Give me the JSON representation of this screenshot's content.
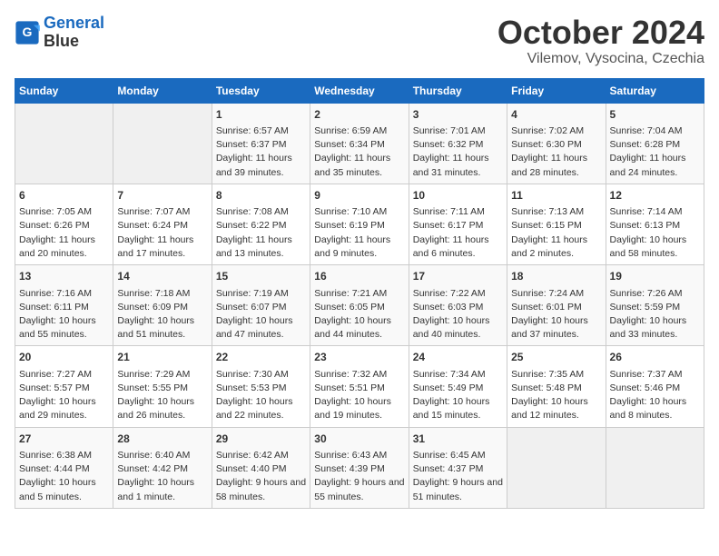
{
  "header": {
    "logo_line1": "General",
    "logo_line2": "Blue",
    "month": "October 2024",
    "location": "Vilemov, Vysocina, Czechia"
  },
  "days_of_week": [
    "Sunday",
    "Monday",
    "Tuesday",
    "Wednesday",
    "Thursday",
    "Friday",
    "Saturday"
  ],
  "weeks": [
    [
      {
        "day": "",
        "info": ""
      },
      {
        "day": "",
        "info": ""
      },
      {
        "day": "1",
        "info": "Sunrise: 6:57 AM\nSunset: 6:37 PM\nDaylight: 11 hours and 39 minutes."
      },
      {
        "day": "2",
        "info": "Sunrise: 6:59 AM\nSunset: 6:34 PM\nDaylight: 11 hours and 35 minutes."
      },
      {
        "day": "3",
        "info": "Sunrise: 7:01 AM\nSunset: 6:32 PM\nDaylight: 11 hours and 31 minutes."
      },
      {
        "day": "4",
        "info": "Sunrise: 7:02 AM\nSunset: 6:30 PM\nDaylight: 11 hours and 28 minutes."
      },
      {
        "day": "5",
        "info": "Sunrise: 7:04 AM\nSunset: 6:28 PM\nDaylight: 11 hours and 24 minutes."
      }
    ],
    [
      {
        "day": "6",
        "info": "Sunrise: 7:05 AM\nSunset: 6:26 PM\nDaylight: 11 hours and 20 minutes."
      },
      {
        "day": "7",
        "info": "Sunrise: 7:07 AM\nSunset: 6:24 PM\nDaylight: 11 hours and 17 minutes."
      },
      {
        "day": "8",
        "info": "Sunrise: 7:08 AM\nSunset: 6:22 PM\nDaylight: 11 hours and 13 minutes."
      },
      {
        "day": "9",
        "info": "Sunrise: 7:10 AM\nSunset: 6:19 PM\nDaylight: 11 hours and 9 minutes."
      },
      {
        "day": "10",
        "info": "Sunrise: 7:11 AM\nSunset: 6:17 PM\nDaylight: 11 hours and 6 minutes."
      },
      {
        "day": "11",
        "info": "Sunrise: 7:13 AM\nSunset: 6:15 PM\nDaylight: 11 hours and 2 minutes."
      },
      {
        "day": "12",
        "info": "Sunrise: 7:14 AM\nSunset: 6:13 PM\nDaylight: 10 hours and 58 minutes."
      }
    ],
    [
      {
        "day": "13",
        "info": "Sunrise: 7:16 AM\nSunset: 6:11 PM\nDaylight: 10 hours and 55 minutes."
      },
      {
        "day": "14",
        "info": "Sunrise: 7:18 AM\nSunset: 6:09 PM\nDaylight: 10 hours and 51 minutes."
      },
      {
        "day": "15",
        "info": "Sunrise: 7:19 AM\nSunset: 6:07 PM\nDaylight: 10 hours and 47 minutes."
      },
      {
        "day": "16",
        "info": "Sunrise: 7:21 AM\nSunset: 6:05 PM\nDaylight: 10 hours and 44 minutes."
      },
      {
        "day": "17",
        "info": "Sunrise: 7:22 AM\nSunset: 6:03 PM\nDaylight: 10 hours and 40 minutes."
      },
      {
        "day": "18",
        "info": "Sunrise: 7:24 AM\nSunset: 6:01 PM\nDaylight: 10 hours and 37 minutes."
      },
      {
        "day": "19",
        "info": "Sunrise: 7:26 AM\nSunset: 5:59 PM\nDaylight: 10 hours and 33 minutes."
      }
    ],
    [
      {
        "day": "20",
        "info": "Sunrise: 7:27 AM\nSunset: 5:57 PM\nDaylight: 10 hours and 29 minutes."
      },
      {
        "day": "21",
        "info": "Sunrise: 7:29 AM\nSunset: 5:55 PM\nDaylight: 10 hours and 26 minutes."
      },
      {
        "day": "22",
        "info": "Sunrise: 7:30 AM\nSunset: 5:53 PM\nDaylight: 10 hours and 22 minutes."
      },
      {
        "day": "23",
        "info": "Sunrise: 7:32 AM\nSunset: 5:51 PM\nDaylight: 10 hours and 19 minutes."
      },
      {
        "day": "24",
        "info": "Sunrise: 7:34 AM\nSunset: 5:49 PM\nDaylight: 10 hours and 15 minutes."
      },
      {
        "day": "25",
        "info": "Sunrise: 7:35 AM\nSunset: 5:48 PM\nDaylight: 10 hours and 12 minutes."
      },
      {
        "day": "26",
        "info": "Sunrise: 7:37 AM\nSunset: 5:46 PM\nDaylight: 10 hours and 8 minutes."
      }
    ],
    [
      {
        "day": "27",
        "info": "Sunrise: 6:38 AM\nSunset: 4:44 PM\nDaylight: 10 hours and 5 minutes."
      },
      {
        "day": "28",
        "info": "Sunrise: 6:40 AM\nSunset: 4:42 PM\nDaylight: 10 hours and 1 minute."
      },
      {
        "day": "29",
        "info": "Sunrise: 6:42 AM\nSunset: 4:40 PM\nDaylight: 9 hours and 58 minutes."
      },
      {
        "day": "30",
        "info": "Sunrise: 6:43 AM\nSunset: 4:39 PM\nDaylight: 9 hours and 55 minutes."
      },
      {
        "day": "31",
        "info": "Sunrise: 6:45 AM\nSunset: 4:37 PM\nDaylight: 9 hours and 51 minutes."
      },
      {
        "day": "",
        "info": ""
      },
      {
        "day": "",
        "info": ""
      }
    ]
  ]
}
